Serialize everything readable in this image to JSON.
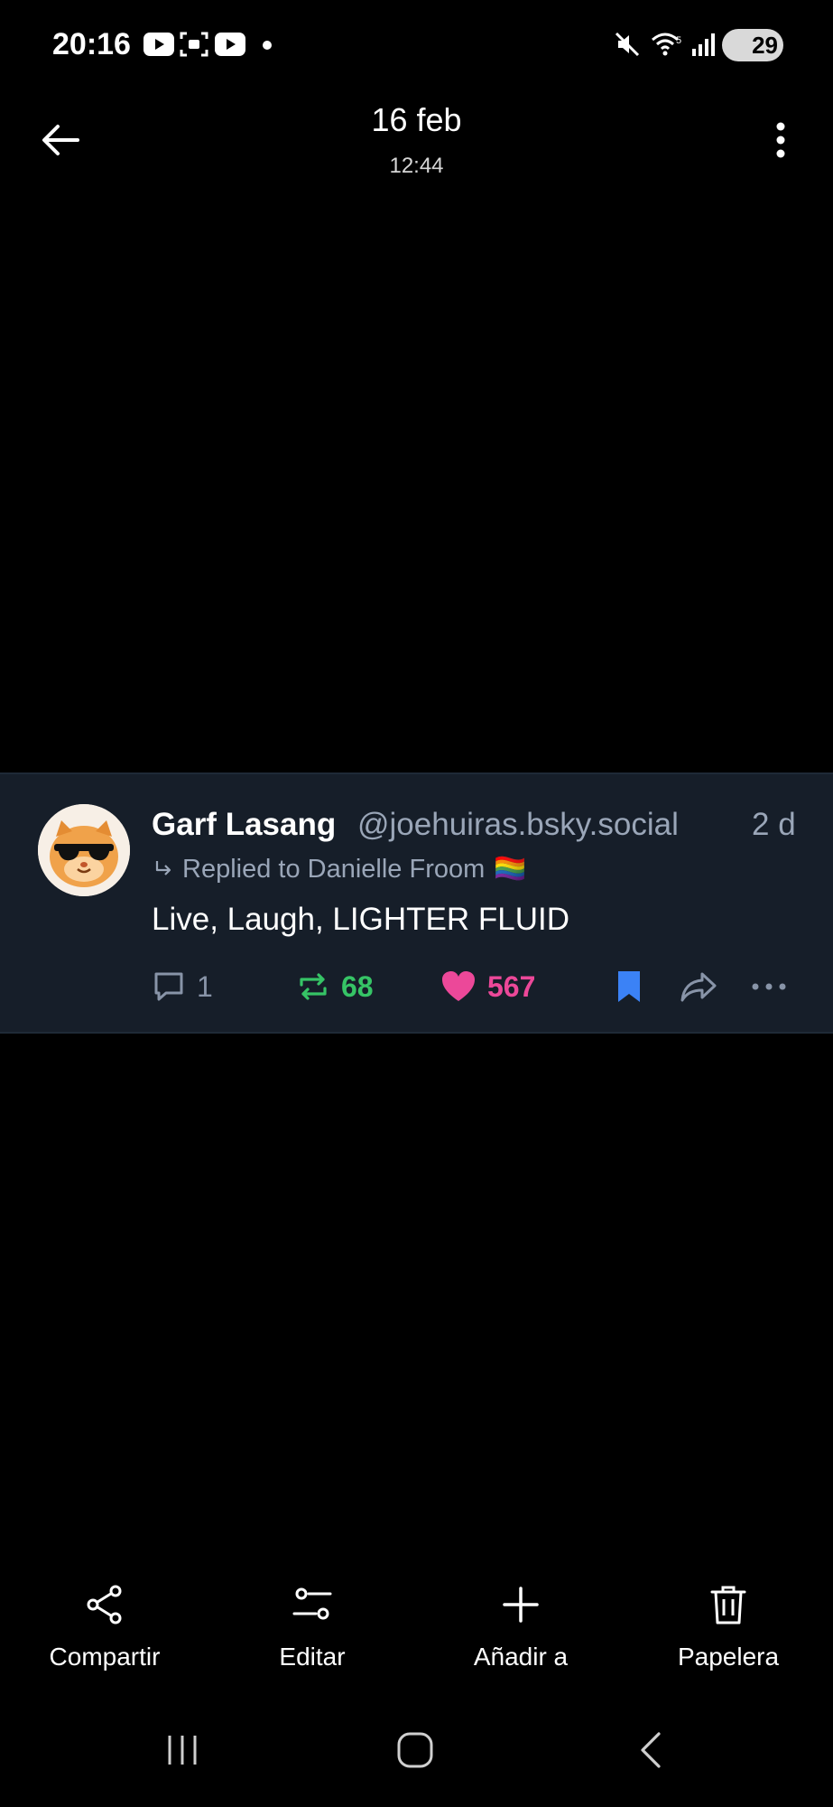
{
  "status_bar": {
    "time": "20:16",
    "battery": "29",
    "icons": [
      "youtube-icon",
      "screen-record-icon",
      "youtube-icon",
      "dot-icon",
      "mute-icon",
      "wifi-icon",
      "signal-icon",
      "battery-icon"
    ]
  },
  "header": {
    "date": "16 feb",
    "time": "12:44"
  },
  "post": {
    "author_name": "Garf Lasang",
    "handle": "@joehuiras.bsky.social",
    "age": "2 d",
    "reply_to": "Replied to Danielle Froom",
    "reply_flag": "🏳️‍🌈",
    "text": "Live, Laugh, LIGHTER FLUID",
    "replies": "1",
    "reposts": "68",
    "likes": "567"
  },
  "bottom_actions": [
    {
      "label": "Compartir",
      "icon": "share-icon"
    },
    {
      "label": "Editar",
      "icon": "edit-icon"
    },
    {
      "label": "Añadir a",
      "icon": "plus-icon"
    },
    {
      "label": "Papelera",
      "icon": "trash-icon"
    }
  ],
  "colors": {
    "card_bg": "#161e29",
    "repost": "#36c466",
    "like": "#ec4899",
    "bookmark": "#3b82f6",
    "muted": "#9aa6b8"
  }
}
